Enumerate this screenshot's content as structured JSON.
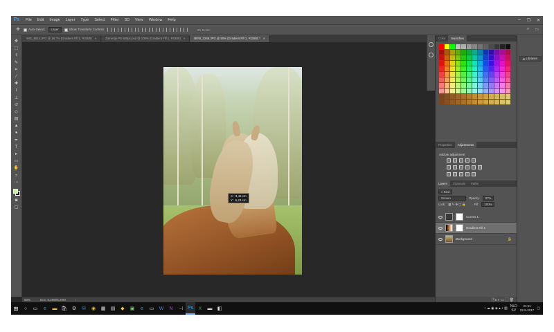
{
  "app": {
    "logo": "Ps",
    "menu": [
      "File",
      "Edit",
      "Image",
      "Layer",
      "Type",
      "Select",
      "Filter",
      "3D",
      "View",
      "Window",
      "Help"
    ],
    "window_controls": [
      "–",
      "❐",
      "✕"
    ]
  },
  "options": {
    "auto_select_label": "Auto-Select:",
    "auto_select_value": "Layer",
    "transform_label": "Show Transform Controls",
    "mode_3d": "3D Mode:"
  },
  "tabs": [
    {
      "label": "IMG_8014.JPG @ 16,7% (Gradient Fill 1, RGB/8)",
      "close": "×"
    },
    {
      "label": "Zomertje PS 500px.psd @ 100% (Gradient Fill 1, RGB/8)",
      "close": "×"
    },
    {
      "label": "BEW_3248.JPG @ 50% (Gradient Fill 1, RGB/8) *",
      "close": "×"
    }
  ],
  "toolbar": {
    "tools": [
      "move",
      "marquee",
      "lasso",
      "quick-select",
      "crop",
      "eyedropper",
      "healing",
      "brush",
      "clone",
      "history-brush",
      "eraser",
      "gradient",
      "blur",
      "dodge",
      "pen",
      "type",
      "path-select",
      "shape",
      "hand",
      "zoom",
      "more"
    ]
  },
  "canvas": {
    "tooltip_x": "X : 3,46 cm",
    "tooltip_y": "Y : 6,23 cm"
  },
  "status": {
    "zoom": "50%",
    "doc": "Doc: 6,29M/6,29M"
  },
  "panels": {
    "color_tabs": [
      "Color",
      "Swatches"
    ],
    "adj_tabs": [
      "Properties",
      "Adjustments"
    ],
    "adj_title": "Add an adjustment",
    "layers_tabs": [
      "Layers",
      "Channels",
      "Paths"
    ],
    "kind_label": "Kind",
    "blend_mode": "Screen",
    "opacity_label": "Opacity:",
    "opacity_value": "57%",
    "lock_label": "Lock:",
    "fill_label": "Fill:",
    "fill_value": "100%",
    "layers": [
      {
        "name": "Curves 1",
        "selected": false
      },
      {
        "name": "Gradient Fill 1",
        "selected": true
      },
      {
        "name": "Background",
        "selected": false
      }
    ],
    "bottom_icons": "ⓕx  ◐  ▭  ▢  🗑"
  },
  "libraries": {
    "label": "Libraries"
  },
  "taskbar": {
    "start": "⊞",
    "locale": "NLD",
    "locale_sub": "SV",
    "time": "21:11",
    "date": "22-5-2017"
  },
  "colors": {
    "fg": "#c8f2a2",
    "bg": "#000000",
    "ui_gray": "#535353"
  }
}
